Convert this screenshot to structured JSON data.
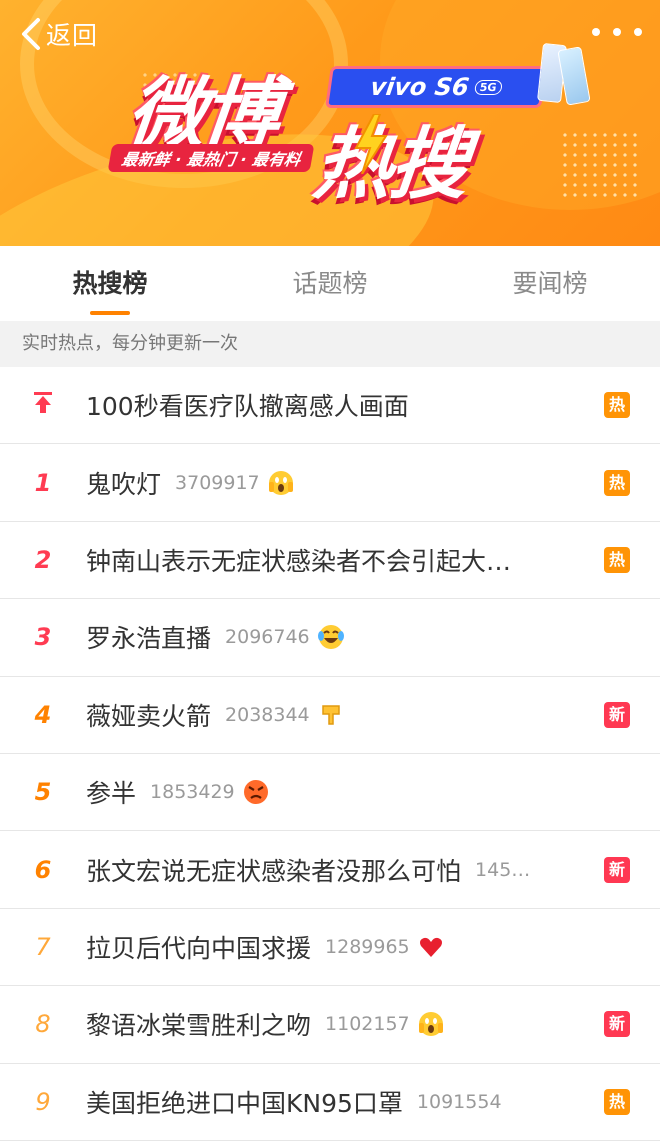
{
  "header": {
    "back_label": "返回",
    "logo_title_1": "微博",
    "logo_title_2": "热搜",
    "logo_tagline": "最新鲜 · 最热门 · 最有料",
    "sponsor_badge": "vivo S6",
    "sponsor_5g": "5G"
  },
  "tabs": [
    {
      "label": "热搜榜",
      "active": true
    },
    {
      "label": "话题榜",
      "active": false
    },
    {
      "label": "要闻榜",
      "active": false
    }
  ],
  "section_header": "实时热点，每分钟更新一次",
  "rows": [
    {
      "rank": "",
      "pinned": true,
      "title": "100秒看医疗队撤离感人画面",
      "count": "",
      "emoji": "",
      "badge": "热",
      "badge_type": "hot"
    },
    {
      "rank": "1",
      "title": "鬼吹灯",
      "count": "3709917",
      "emoji": "scream-face-icon",
      "badge": "热",
      "badge_type": "hot"
    },
    {
      "rank": "2",
      "title": "钟南山表示无症状感染者不会引起大…",
      "count": "",
      "emoji": "",
      "badge": "热",
      "badge_type": "hot"
    },
    {
      "rank": "3",
      "title": "罗永浩直播",
      "count": "2096746",
      "emoji": "laughing-tears-icon",
      "badge": "",
      "badge_type": ""
    },
    {
      "rank": "4",
      "title": "薇娅卖火箭",
      "count": "2038344",
      "emoji": "hand-point-down-icon",
      "badge": "新",
      "badge_type": "new"
    },
    {
      "rank": "5",
      "title": "参半",
      "count": "1853429",
      "emoji": "angry-face-icon",
      "badge": "",
      "badge_type": ""
    },
    {
      "rank": "6",
      "title": "张文宏说无症状感染者没那么可怕",
      "count": "145…",
      "emoji": "",
      "badge": "新",
      "badge_type": "new"
    },
    {
      "rank": "7",
      "title": "拉贝后代向中国求援",
      "count": "1289965",
      "emoji": "red-heart-icon",
      "badge": "",
      "badge_type": ""
    },
    {
      "rank": "8",
      "title": "黎语冰棠雪胜利之吻",
      "count": "1102157",
      "emoji": "scream-face-icon",
      "badge": "新",
      "badge_type": "new"
    },
    {
      "rank": "9",
      "title": "美国拒绝进口中国KN95口罩",
      "count": "1091554",
      "emoji": "",
      "badge": "热",
      "badge_type": "hot"
    }
  ],
  "colors": {
    "accent": "#ff8200",
    "rank_top": "#ff3b52",
    "hot_badge": "#ff9406",
    "new_badge": "#ff3852"
  }
}
